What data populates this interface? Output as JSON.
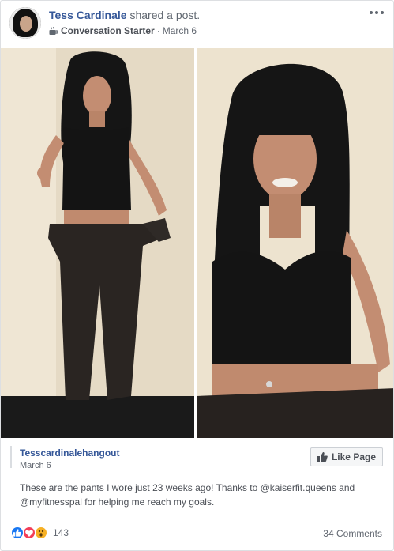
{
  "header": {
    "author": "Tess Cardinale",
    "action": "shared a post.",
    "group": "Conversation Starter",
    "separator": "·",
    "date": "March 6"
  },
  "shared_post": {
    "page_name": "Tesscardinalehangout",
    "date": "March 6",
    "like_page_label": "Like Page",
    "caption": "These are the pants I wore just 23 weeks ago! Thanks to @kaiserfit.queens and @myfitnesspal for helping me reach my goals."
  },
  "footer": {
    "reaction_count": "143",
    "comments": "34 Comments"
  },
  "colors": {
    "link": "#365899",
    "like_blue": "#1877f2",
    "love_red": "#f33e58",
    "wow_yellow": "#f7b125"
  },
  "icons": [
    "coffee-cup-icon",
    "more-options-icon",
    "thumbs-up-icon",
    "like-reaction-icon",
    "love-reaction-icon",
    "wow-reaction-icon"
  ]
}
